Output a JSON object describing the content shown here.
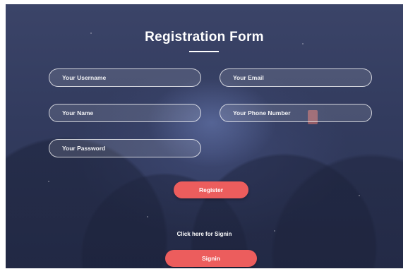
{
  "form": {
    "title": "Registration Form",
    "fields": {
      "username": {
        "placeholder": "Your Username"
      },
      "email": {
        "placeholder": "Your Email"
      },
      "name": {
        "placeholder": "Your Name"
      },
      "phone": {
        "placeholder": "Your Phone Number"
      },
      "password": {
        "placeholder": "Your Password"
      }
    },
    "register_label": "Register",
    "signin_prompt": "Click here for Signin",
    "signin_label": "Signin"
  },
  "colors": {
    "background": "#323b5e",
    "accent": "#ec5d5d",
    "text": "#ffffff"
  }
}
